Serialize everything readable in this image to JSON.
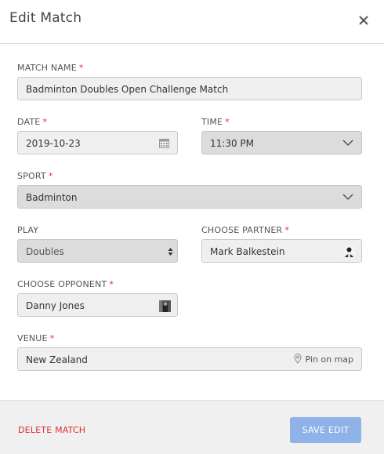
{
  "modal": {
    "title": "Edit Match",
    "close_icon": "close-icon"
  },
  "form": {
    "match_name": {
      "label": "MATCH NAME",
      "required": "*",
      "value": "Badminton Doubles Open Challenge Match"
    },
    "date": {
      "label": "DATE",
      "required": "*",
      "value": "2019-10-23",
      "icon": "calendar-icon"
    },
    "time": {
      "label": "TIME",
      "required": "*",
      "value": "11:30 PM",
      "icon": "chevron-down-icon"
    },
    "sport": {
      "label": "SPORT",
      "required": "*",
      "value": "Badminton",
      "icon": "chevron-down-icon"
    },
    "play": {
      "label": "PLAY",
      "value": "Doubles",
      "icon": "updown-icon"
    },
    "partner": {
      "label": "CHOOSE PARTNER",
      "required": "*",
      "value": "Mark Balkestein",
      "icon": "avatar"
    },
    "opponent": {
      "label": "CHOOSE OPPONENT",
      "required": "*",
      "value": "Danny Jones",
      "icon": "avatar"
    },
    "venue": {
      "label": "VENUE",
      "required": "*",
      "value": "New Zealand",
      "pin_label": "Pin on map",
      "icon": "map-pin-icon"
    }
  },
  "footer": {
    "delete_label": "DELETE MATCH",
    "save_label": "SAVE EDIT"
  },
  "colors": {
    "required": "#e32b2b",
    "save_button": "#8fb2e8",
    "footer_bg": "#f0f0f0"
  }
}
